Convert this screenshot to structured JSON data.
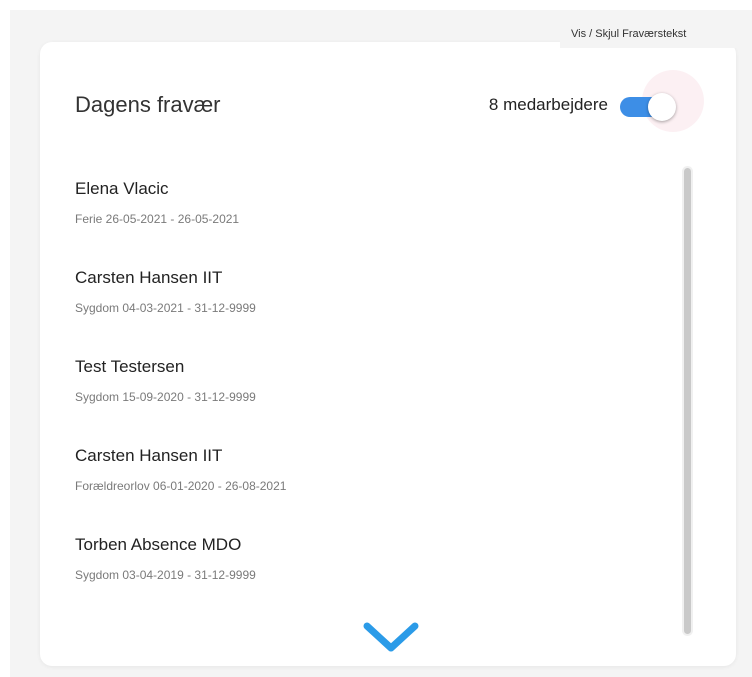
{
  "tooltip": {
    "text": "Vis / Skjul Fraværstekst"
  },
  "card": {
    "title": "Dagens fravær",
    "count_label": "8 medarbejdere",
    "toggle_on": true
  },
  "absences": [
    {
      "name": "Elena Vlacic",
      "detail": "Ferie 26-05-2021 - 26-05-2021"
    },
    {
      "name": "Carsten Hansen IIT",
      "detail": "Sygdom 04-03-2021 - 31-12-9999"
    },
    {
      "name": "Test Testersen",
      "detail": "Sygdom 15-09-2020 - 31-12-9999"
    },
    {
      "name": "Carsten Hansen IIT",
      "detail": "Forældreorlov 06-01-2020 - 26-08-2021"
    },
    {
      "name": "Torben Absence MDO",
      "detail": "Sygdom 03-04-2019 - 31-12-9999"
    }
  ],
  "icons": {
    "expand": "chevron-down-icon"
  },
  "colors": {
    "accent": "#3d8ee6",
    "chevron": "#2b9be8",
    "muted_text": "#7a7a7a"
  }
}
